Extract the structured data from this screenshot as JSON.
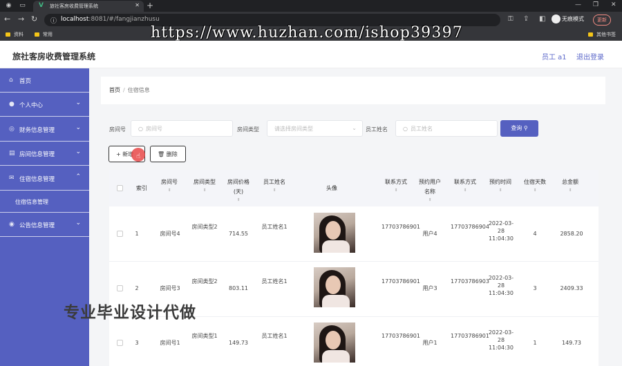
{
  "browser": {
    "tab_title": "旅社客房收费管理系统",
    "url_host": "localhost",
    "url_path": ":8081/#/fangjianzhusu",
    "incognito_label": "无痕模式",
    "update_label": "更新",
    "bookmarks": [
      "资料",
      "常用"
    ],
    "bookmarks_right": "其他书签"
  },
  "overlay": {
    "top_watermark": "https://www.huzhan.com/ishop39397",
    "bottom_watermark": "专业毕业设计代做"
  },
  "header": {
    "title": "旅社客房收费管理系统",
    "user_label": "员工 a1",
    "logout_label": "退出登录"
  },
  "sidebar": {
    "items": [
      {
        "label": "首页",
        "icon": "home-icon"
      },
      {
        "label": "个人中心",
        "icon": "user-icon"
      },
      {
        "label": "财务信息管理",
        "icon": "finance-icon"
      },
      {
        "label": "房间信息管理",
        "icon": "room-icon"
      },
      {
        "label": "住宿信息管理",
        "icon": "mail-icon"
      },
      {
        "label": "公告信息管理",
        "icon": "notice-icon"
      }
    ],
    "sub_item": "住宿信息管理"
  },
  "breadcrumb": {
    "home": "首页",
    "separator": "/",
    "current": "住宿信息"
  },
  "search": {
    "room_no_label": "房间号",
    "room_no_placeholder": "房间号",
    "room_type_label": "房间类型",
    "room_type_placeholder": "请选择房间类型",
    "staff_label": "员工姓名",
    "staff_placeholder": "员工姓名",
    "query_button": "查询"
  },
  "actions": {
    "add": "新增",
    "delete": "删除"
  },
  "table": {
    "headers": [
      "索引",
      "房间号",
      "房间类型",
      "房间价格(天)",
      "员工姓名",
      "头像",
      "联系方式",
      "预约用户名称",
      "联系方式",
      "预约时间",
      "住宿天数",
      "总金额"
    ],
    "rows": [
      {
        "index": "1",
        "room_no": "房间号4",
        "room_type": "房间类型2",
        "price": "714.55",
        "staff": "员工姓名1",
        "contact": "17703786901",
        "user": "用户4",
        "user_contact": "17703786904",
        "time": "2022-03-28 11:04:30",
        "days": "4",
        "total": "2858.20"
      },
      {
        "index": "2",
        "room_no": "房间号3",
        "room_type": "房间类型2",
        "price": "803.11",
        "staff": "员工姓名1",
        "contact": "17703786901",
        "user": "用户3",
        "user_contact": "17703786903",
        "time": "2022-03-28 11:04:30",
        "days": "3",
        "total": "2409.33"
      },
      {
        "index": "3",
        "room_no": "房间号1",
        "room_type": "房间类型1",
        "price": "149.73",
        "staff": "员工姓名1",
        "contact": "17703786901",
        "user": "用户1",
        "user_contact": "17703786901",
        "time": "2022-03-28 11:04:30",
        "days": "1",
        "total": "149.73"
      }
    ]
  }
}
